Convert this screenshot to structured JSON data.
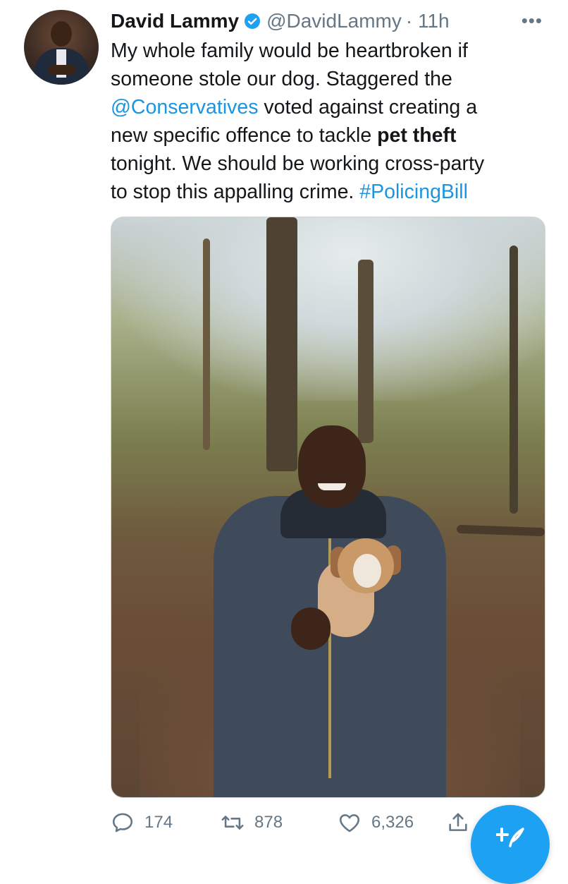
{
  "tweet": {
    "author": {
      "name": "David Lammy",
      "handle": "@DavidLammy",
      "time": "· 11h",
      "verified_color": "#1da1f2"
    },
    "more_label": "•••",
    "lines": [
      {
        "segments": [
          {
            "text": "My whole family would be heartbroken if"
          }
        ]
      },
      {
        "segments": [
          {
            "text": "someone stole our dog. Staggered the"
          }
        ]
      },
      {
        "segments": [
          {
            "text": "@Conservatives",
            "link": true
          },
          {
            "text": " voted against creating a"
          }
        ]
      },
      {
        "segments": [
          {
            "text": "new specific offence to tackle "
          },
          {
            "text": "pet theft",
            "bold": true
          }
        ]
      },
      {
        "segments": [
          {
            "text": "tonight. We should be working cross-party"
          }
        ]
      },
      {
        "segments": [
          {
            "text": "to stop this appalling crime. "
          },
          {
            "text": "#PolicingBill",
            "link": true
          }
        ]
      }
    ],
    "link_color": "#1b95e0",
    "stats": {
      "replies": "174",
      "retweets": "878",
      "likes": "6,326"
    }
  },
  "icons": {
    "reply": "reply-bubble-icon",
    "retweet": "retweet-icon",
    "like": "heart-icon",
    "share": "share-icon",
    "compose": "compose-tweet-icon"
  },
  "accent_color": "#1da1f2"
}
